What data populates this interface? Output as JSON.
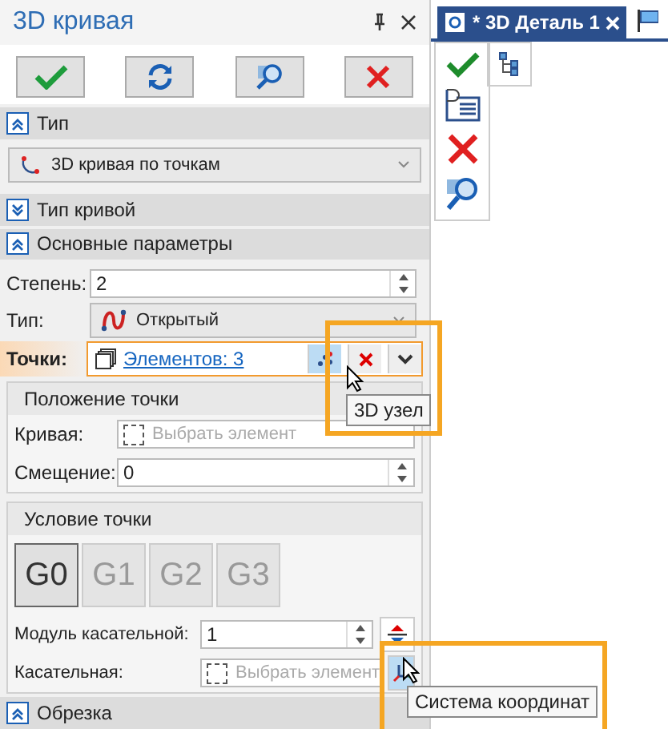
{
  "panel": {
    "title": "3D кривая"
  },
  "sections": [
    {
      "title": "Тип",
      "expanded": true,
      "kind": "type"
    },
    {
      "title": "Тип кривой",
      "expanded": false,
      "kind": "empty"
    },
    {
      "title": "Основные параметры",
      "expanded": true,
      "kind": "params"
    },
    {
      "title": "Обрезка",
      "expanded": true,
      "kind": "empty"
    }
  ],
  "type_dropdown": {
    "value": "3D кривая по точкам"
  },
  "params": {
    "degree": {
      "label": "Степень:",
      "value": "2"
    },
    "curve_type": {
      "label": "Тип:",
      "value": "Открытый"
    },
    "points": {
      "label": "Точки:",
      "value": "Элементов: 3"
    }
  },
  "point_position": {
    "title": "Положение точки",
    "curve": {
      "label": "Кривая:",
      "placeholder": "Выбрать элемент"
    },
    "offset": {
      "label": "Смещение:",
      "value": "0"
    }
  },
  "point_condition": {
    "title": "Условие точки",
    "g_buttons": [
      {
        "label": "G0",
        "selected": true
      },
      {
        "label": "G1",
        "selected": false
      },
      {
        "label": "G2",
        "selected": false
      },
      {
        "label": "G3",
        "selected": false
      }
    ],
    "tangent_modulus": {
      "label": "Модуль касательной:",
      "value": "1"
    },
    "tangent": {
      "label": "Касательная:",
      "placeholder": "Выбрать элемент"
    }
  },
  "tooltips": [
    "3D узел",
    "Система координат"
  ],
  "document_tab": {
    "title": "* 3D Деталь 1"
  }
}
